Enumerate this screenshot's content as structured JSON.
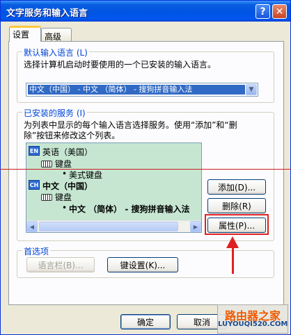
{
  "window": {
    "title": "文字服务和输入语言",
    "help_glyph": "?",
    "close_glyph": "✕"
  },
  "tabs": [
    {
      "label": "设置",
      "active": true
    },
    {
      "label": "高级",
      "active": false
    }
  ],
  "default_language": {
    "legend": "默认输入语言 (L)",
    "description": "选择计算机启动时要使用的一个已安装的输入语言。",
    "selected": "中文（中国） - 中文 （简体） - 搜狗拼音输入法"
  },
  "installed_services": {
    "legend": "已安装的服务 (I)",
    "description_line1": "为列表中显示的每个输入语言选择服务。使用“添加”和“删",
    "description_line2": "除”按钮来修改这个列表。",
    "tree": {
      "lang1": {
        "badge": "EN",
        "label": "英语（美国）",
        "category": "键盘",
        "item": "美式键盘"
      },
      "lang2": {
        "badge": "CH",
        "label": "中文（中国）",
        "category": "键盘",
        "item": "中文 （简体） - 搜狗拼音输入法"
      }
    },
    "buttons": {
      "add": "添加(D)...",
      "remove": "删除(R)",
      "properties": "属性(P)..."
    }
  },
  "preferences": {
    "legend": "首选项",
    "language_bar": "语言栏(B)...",
    "key_settings": "键设置(K)..."
  },
  "footer": {
    "ok": "确定",
    "cancel": "取消"
  },
  "watermark": {
    "title": "路由器之家",
    "url": "LUYOUQI520.COM"
  },
  "colors": {
    "titlebar": "#0054e3",
    "annotation": "#e02020",
    "selection": "#316ac5",
    "tree_bg": "#c6e6d2"
  }
}
